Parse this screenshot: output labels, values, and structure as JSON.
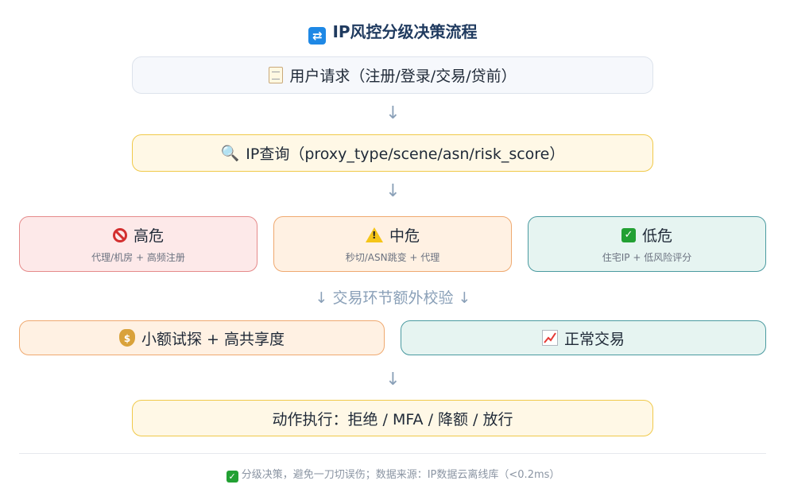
{
  "title": "IP风控分级决策流程",
  "title_icon": "repeat-icon",
  "request": {
    "icon": "memo-icon",
    "label": "用户请求（注册/登录/交易/贷前）"
  },
  "query": {
    "icon": "magnifier-icon",
    "label": "IP查询（proxy_type/scene/asn/risk_score）"
  },
  "risk_levels": [
    {
      "icon": "prohibited-icon",
      "label": "高危",
      "sub": "代理/机房 + 高频注册",
      "color": "#e57373"
    },
    {
      "icon": "warning-icon",
      "label": "中危",
      "sub": "秒切/ASN跳变 + 代理",
      "color": "#f0a35e"
    },
    {
      "icon": "check-icon",
      "label": "低危",
      "sub": "住宅IP + 低风险评分",
      "color": "#2e8b8b"
    }
  ],
  "middle_note": "↓ 交易环节额外校验 ↓",
  "checks": [
    {
      "icon": "money-bag-icon",
      "label": "小额试探 + 高共享度"
    },
    {
      "icon": "chart-up-icon",
      "label": "正常交易"
    }
  ],
  "action": {
    "label": "动作执行：拒绝 / MFA / 降额 / 放行"
  },
  "arrow_glyph": "↓",
  "footer": "分级决策，避免一刀切误伤；数据来源：IP数据云离线库（<0.2ms）",
  "footer_icon": "check-icon"
}
